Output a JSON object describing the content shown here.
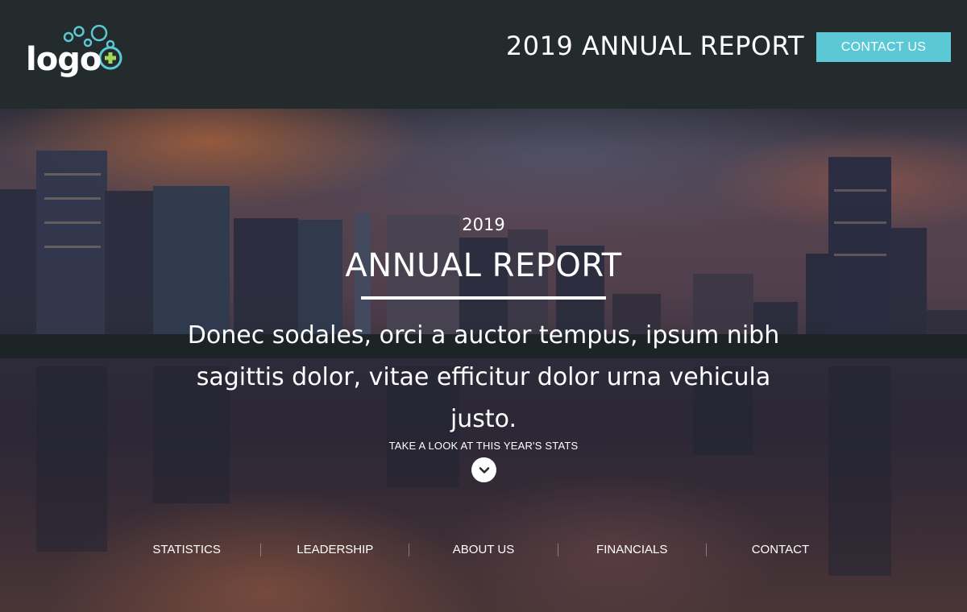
{
  "header": {
    "logo_text": "logo",
    "title": "2019 ANNUAL REPORT",
    "contact_button": "CONTACT US"
  },
  "hero": {
    "year": "2019",
    "title": "ANNUAL REPORT",
    "description": "Donec sodales, orci a auctor tempus, ipsum nibh sagittis dolor, vitae efficitur dolor urna vehicula justo.",
    "cta": "TAKE A LOOK AT THIS YEAR'S STATS",
    "scroll_icon": "chevron-down-icon"
  },
  "nav": {
    "items": [
      {
        "label": "STATISTICS"
      },
      {
        "label": "LEADERSHIP"
      },
      {
        "label": "ABOUT US"
      },
      {
        "label": "FINANCIALS"
      },
      {
        "label": "CONTACT"
      }
    ]
  },
  "colors": {
    "header_bg": "#242b2c",
    "accent": "#5ac8d5",
    "logo_plus": "#a4d65e"
  }
}
